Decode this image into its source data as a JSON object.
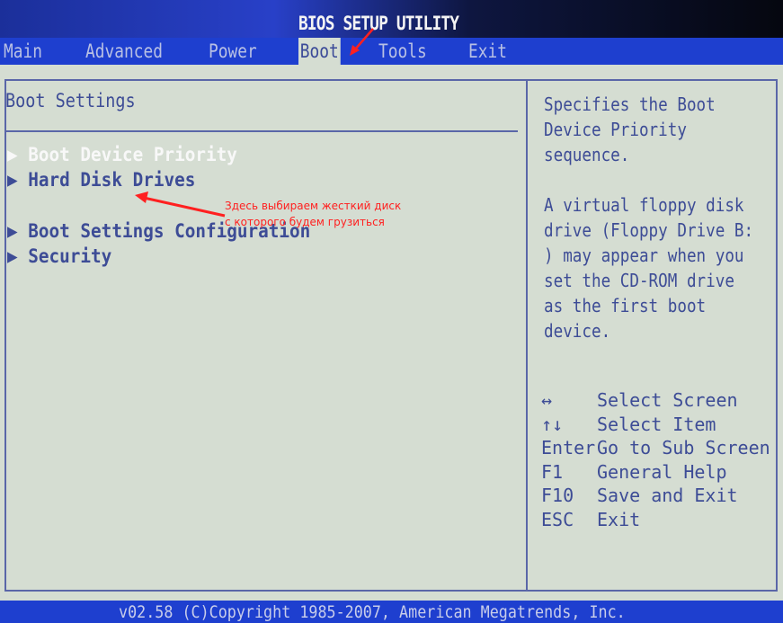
{
  "title": "BIOS SETUP UTILITY",
  "tabs": [
    {
      "label": "Main"
    },
    {
      "label": "Advanced"
    },
    {
      "label": "Power"
    },
    {
      "label": "Boot",
      "active": true
    },
    {
      "label": "Tools"
    },
    {
      "label": "Exit"
    }
  ],
  "main": {
    "heading": "Boot Settings",
    "items": [
      {
        "label": "▶ Boot Device Priority",
        "selected": true
      },
      {
        "label": "▶ Hard Disk Drives"
      },
      {
        "label": "▶ Boot Settings Configuration"
      },
      {
        "label": "▶ Security"
      }
    ]
  },
  "help": {
    "lines": [
      "Specifies the Boot",
      "Device Priority",
      "sequence.",
      "",
      "A virtual floppy disk",
      "drive (Floppy Drive B:",
      ") may appear when you",
      "set the CD-ROM drive",
      "as the first boot",
      "device."
    ],
    "keys": [
      {
        "key": "↔",
        "action": "Select Screen"
      },
      {
        "key": "↑↓",
        "action": "Select Item"
      },
      {
        "key": "Enter",
        "action": "Go to Sub Screen"
      },
      {
        "key": "F1",
        "action": "General Help"
      },
      {
        "key": "F10",
        "action": "Save and Exit"
      },
      {
        "key": "ESC",
        "action": "Exit"
      }
    ]
  },
  "annotation": {
    "line1": "Здесь выбираем жесткий диск",
    "line2": "с которого будем грузиться",
    "color": "#ff2020"
  },
  "footer": "v02.58 (C)Copyright 1985-2007, American Megatrends, Inc.",
  "colors": {
    "bar": "#1e3fcf",
    "background": "#d5ddd2",
    "text": "#3d4c96"
  }
}
